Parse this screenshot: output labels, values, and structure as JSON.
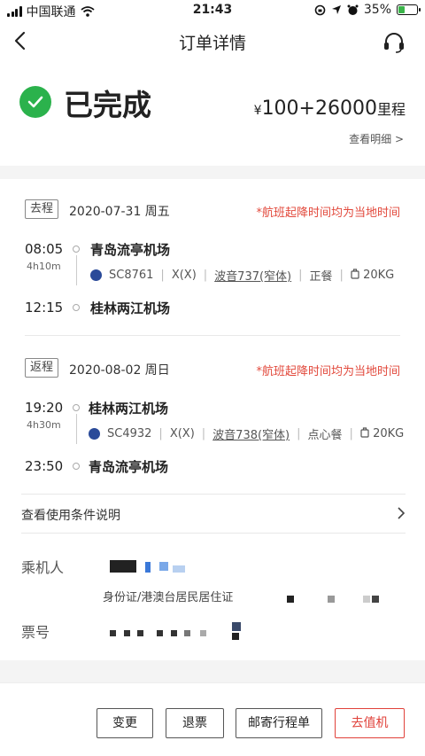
{
  "status_bar": {
    "carrier": "中国联通",
    "time": "21:43",
    "battery": "35%",
    "battery_level": 0.35
  },
  "nav": {
    "title": "订单详情"
  },
  "order": {
    "status": "已完成",
    "price_currency": "¥",
    "price_value": "100+26000",
    "price_unit": "里程",
    "detail_link": "查看明细 >"
  },
  "outbound": {
    "tag": "去程",
    "date": "2020-07-31 周五",
    "note": "*航班起降时间均为当地时间",
    "dep_time": "08:05",
    "duration": "4h10m",
    "dep_airport": "青岛流亭机场",
    "flight_no": "SC8761",
    "cabin": "X(X)",
    "aircraft": "波音737(窄体)",
    "meal": "正餐",
    "baggage": "20KG",
    "arr_time": "12:15",
    "arr_airport": "桂林两江机场"
  },
  "return": {
    "tag": "返程",
    "date": "2020-08-02 周日",
    "note": "*航班起降时间均为当地时间",
    "dep_time": "19:20",
    "duration": "4h30m",
    "dep_airport": "桂林两江机场",
    "flight_no": "SC4932",
    "cabin": "X(X)",
    "aircraft": "波音738(窄体)",
    "meal": "点心餐",
    "baggage": "20KG",
    "arr_time": "23:50",
    "arr_airport": "青岛流亭机场"
  },
  "conditions": {
    "label": "查看使用条件说明"
  },
  "passenger": {
    "label": "乘机人",
    "id_type": "身份证/港澳台居民居住证"
  },
  "ticket": {
    "label": "票号"
  },
  "actions": {
    "change": "变更",
    "refund": "退票",
    "mail_itinerary": "邮寄行程单",
    "check_in": "去值机"
  },
  "colors": {
    "accent_red": "#e0413a",
    "success_green": "#2bb24c",
    "airline_blue": "#2a4a99"
  },
  "icons": [
    "back-icon",
    "headset-icon",
    "check-circle-icon",
    "airline-logo-icon",
    "baggage-icon",
    "chevron-right-icon"
  ]
}
